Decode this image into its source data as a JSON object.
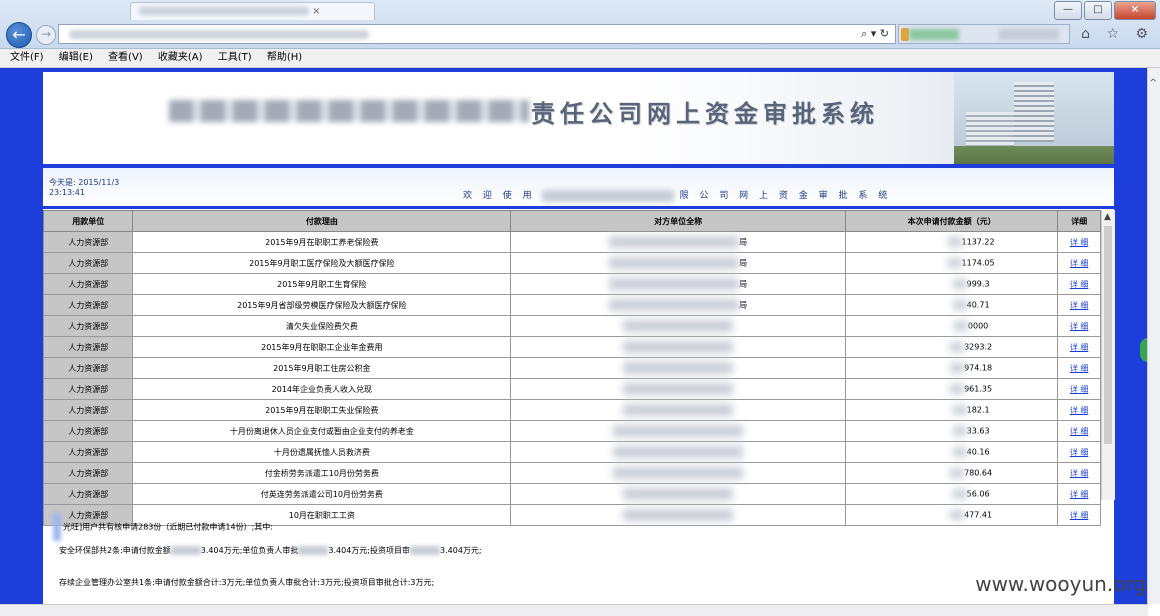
{
  "browser": {
    "back_icon": "back-arrow-icon",
    "forward_icon": "forward-arrow-icon",
    "address_tools": "⌕ ▾ ↻",
    "right_icons": "⌂ ☆ ⚙",
    "window_buttons": [
      "—",
      "□",
      "×"
    ]
  },
  "menu": {
    "items": [
      "文件(F)",
      "编辑(E)",
      "查看(V)",
      "收藏夹(A)",
      "工具(T)",
      "帮助(H)"
    ]
  },
  "banner": {
    "title_visible": "责任公司网上资金审批系统"
  },
  "info": {
    "date_label": "今天是: 2015/11/3",
    "time": "23:13:41",
    "welcome_prefix": "欢 迎 使 用",
    "welcome_suffix": "限 公 司 网 上 资 金 审 批 系 统"
  },
  "table": {
    "headers": [
      "用款单位",
      "付款理由",
      "对方单位全称",
      "本次申请付款金额（元）",
      "详细"
    ],
    "detail_label": "详 细",
    "rows": [
      {
        "unit": "人力资源部",
        "reason": "2015年9月在职职工养老保险费",
        "party_tail": "局",
        "amount": "1137.22"
      },
      {
        "unit": "人力资源部",
        "reason": "2015年9月职工医疗保险及大额医疗保险",
        "party_tail": "局",
        "amount": "1174.05"
      },
      {
        "unit": "人力资源部",
        "reason": "2015年9月职工生育保险",
        "party_tail": "局",
        "amount": "999.3"
      },
      {
        "unit": "人力资源部",
        "reason": "2015年9月省部级劳模医疗保险及大额医疗保险",
        "party_tail": "局",
        "amount": "40.71"
      },
      {
        "unit": "人力资源部",
        "reason": "清欠失业保险费欠费",
        "party_tail": "",
        "amount": "0000"
      },
      {
        "unit": "人力资源部",
        "reason": "2015年9月在职职工企业年金费用",
        "party_tail": "",
        "amount": "3293.2"
      },
      {
        "unit": "人力资源部",
        "reason": "2015年9月职工住房公积金",
        "party_tail": "",
        "amount": "974.18"
      },
      {
        "unit": "人力资源部",
        "reason": "2014年企业负责人收入兑现",
        "party_tail": "",
        "amount": "961.35"
      },
      {
        "unit": "人力资源部",
        "reason": "2015年9月在职职工失业保险费",
        "party_tail": "",
        "amount": "182.1"
      },
      {
        "unit": "人力资源部",
        "reason": "十月份离退休人员企业支付或暂由企业支付的养老金",
        "party_tail": "",
        "amount": "33.63"
      },
      {
        "unit": "人力资源部",
        "reason": "十月份遗属抚恤人员救济费",
        "party_tail": "",
        "amount": "40.16"
      },
      {
        "unit": "人力资源部",
        "reason": "付金桥劳务派遣工10月份劳务费",
        "party_tail": "",
        "amount": "780.64"
      },
      {
        "unit": "人力资源部",
        "reason": "付英连劳务派遣公司10月份劳务费",
        "party_tail": "",
        "amount": "56.06"
      },
      {
        "unit": "人力资源部",
        "reason": "10月在职职工工资",
        "party_tail": "",
        "amount": "477.41"
      }
    ]
  },
  "summary": {
    "line1": "光旺]用户共有核申请283份（近期已付款申请14份）;其中:",
    "line2_a": "安全环保部共2条:申请付款金额",
    "line2_b": "3.404万元;单位负责人审批",
    "line2_c": "3.404万元;投资项目审",
    "line2_d": "3.404万元;",
    "line3": "存续企业管理办公室共1条:申请付款金额合计:3万元;单位负责人审批合计:3万元;投资项目审批合计:3万元;"
  },
  "watermark": "www.wooyun.org"
}
